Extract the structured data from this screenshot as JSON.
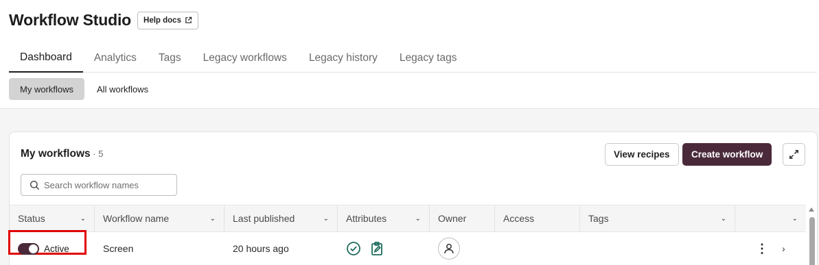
{
  "header": {
    "title": "Workflow Studio",
    "help_label": "Help docs"
  },
  "tabs": [
    {
      "label": "Dashboard",
      "active": true
    },
    {
      "label": "Analytics"
    },
    {
      "label": "Tags"
    },
    {
      "label": "Legacy workflows"
    },
    {
      "label": "Legacy history"
    },
    {
      "label": "Legacy tags"
    }
  ],
  "subtabs": [
    {
      "label": "My workflows",
      "active": true
    },
    {
      "label": "All workflows"
    }
  ],
  "card": {
    "title": "My workflows",
    "count": " · 5",
    "view_recipes_label": "View recipes",
    "create_label": "Create workflow"
  },
  "search": {
    "placeholder": "Search workflow names",
    "value": ""
  },
  "table": {
    "columns": [
      "Status",
      "Workflow name",
      "Last published",
      "Attributes",
      "Owner",
      "Access",
      "Tags",
      ""
    ],
    "rows": [
      {
        "status": "Active",
        "name": "Screen",
        "last_published": "20 hours ago"
      }
    ]
  },
  "colors": {
    "accent": "#4a2a3a",
    "highlight": "#e00000",
    "attribute_icon": "#1f6b5c"
  },
  "icons": [
    "external-link-icon",
    "expand-icon",
    "search-icon",
    "check-circle-icon",
    "clipboard-edit-icon",
    "user-icon",
    "kebab-icon",
    "chevron-right-icon"
  ]
}
